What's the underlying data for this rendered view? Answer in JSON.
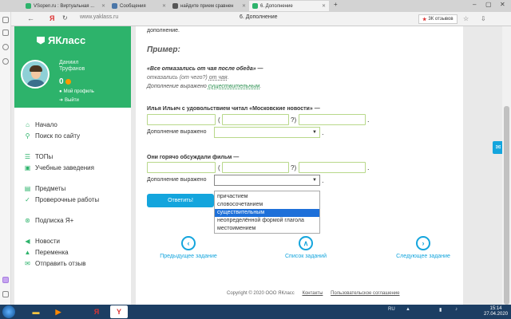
{
  "browser": {
    "tabs": [
      {
        "label": "VSopen.ru : Виртуальная ...",
        "color": "#2db36b"
      },
      {
        "label": "Сообщения",
        "color": "#4a76a8"
      },
      {
        "label": "найдите прием сравнен",
        "color": "#555555"
      },
      {
        "label": "6. Дополнение",
        "color": "#2db36b"
      }
    ],
    "back_icon": "back-arrow-icon",
    "url": "www.yaklass.ru",
    "page_title": "6. Дополнение",
    "reviews_label": "3К отзывов",
    "reviews_star": "★"
  },
  "sidebar": {
    "logo": "ЯКласс",
    "user_first_name": "Даниил",
    "user_last_name": "Труфанов",
    "score": "0",
    "profile_link": "Мой профиль",
    "logout_link": "Выйти",
    "menu_group1": [
      {
        "label": "Начало",
        "icon": "⌂"
      },
      {
        "label": "Поиск по сайту",
        "icon": "⚲"
      }
    ],
    "menu_group2": [
      {
        "label": "ТОПы",
        "icon": "☰"
      },
      {
        "label": "Учебные заведения",
        "icon": "▣"
      }
    ],
    "menu_group3": [
      {
        "label": "Предметы",
        "icon": "▤"
      },
      {
        "label": "Проверочные работы",
        "icon": "✓"
      }
    ],
    "menu_group4": [
      {
        "label": "Подписка Я+",
        "icon": "⊛"
      }
    ],
    "menu_group5": [
      {
        "label": "Новости",
        "icon": "◀"
      },
      {
        "label": "Переменка",
        "icon": "▲"
      },
      {
        "label": "Отправить отзыв",
        "icon": "✉"
      }
    ]
  },
  "task": {
    "intro_tail": "дополнение.",
    "example_heading": "Пример:",
    "example_sentence": "«Все отказались от чая после обеда» —",
    "example_analysis_prefix": "отказались (от чего?) ",
    "example_analysis_word": "от чая",
    "example_analysis_suffix": ".",
    "example_expr_prefix": "Дополнение выражено ",
    "example_expr_word": "существительным",
    "example_expr_suffix": ".",
    "q1_sentence": "Илья Ильич с удовольствием читал «Московские новости» —",
    "q2_sentence": "Они горячо обсуждали фильм —",
    "expr_label": "Дополнение выражено",
    "paren_open": "(",
    "paren_close": "?)",
    "period": ".",
    "answer_button": "Ответить!",
    "dropdown_options": [
      "причастием",
      "словосочетанием",
      "существительным",
      "неопределённой формой глагола",
      "местоимением"
    ],
    "dropdown_highlighted": "существительным"
  },
  "navigation": {
    "prev_label": "Предыдущее задание",
    "list_label": "Список заданий",
    "next_label": "Следующее задание",
    "prev_icon": "‹",
    "list_icon": "∧",
    "next_icon": "›"
  },
  "footer": {
    "copyright": "Copyright © 2020 ООО ЯКласс",
    "contacts": "Контакты",
    "agreement": "Пользовательское соглашение"
  },
  "taskbar": {
    "lang": "RU",
    "time": "15:14",
    "date": "27.04.2020"
  }
}
